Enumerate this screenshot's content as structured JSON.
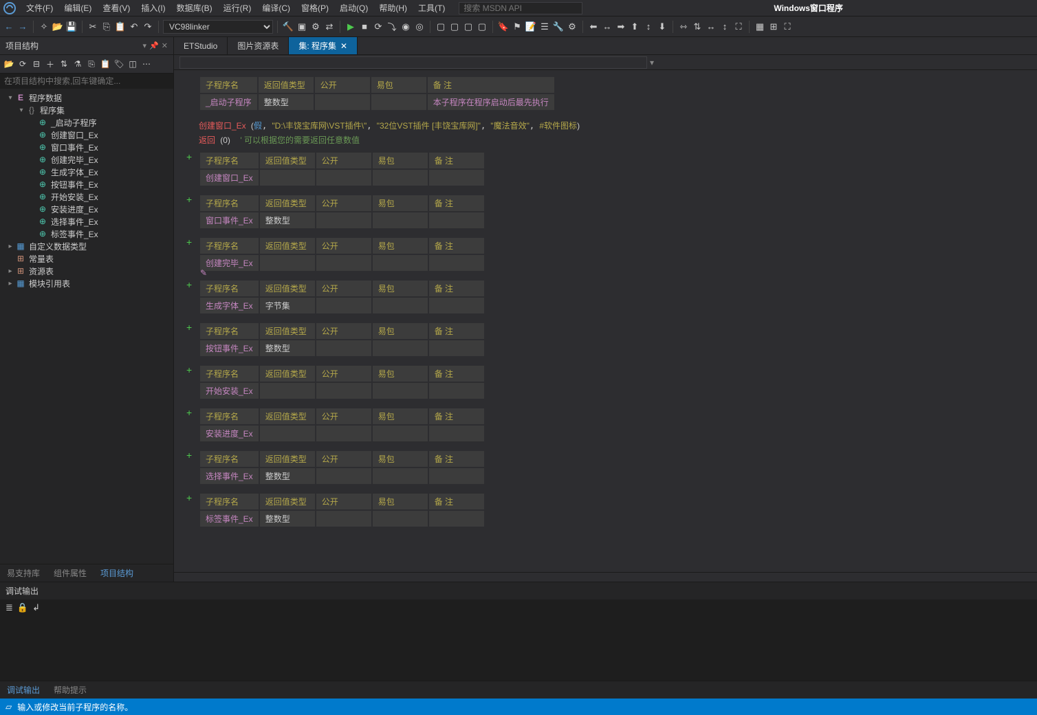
{
  "app_title": "Windows窗口程序",
  "menu": [
    "文件(F)",
    "编辑(E)",
    "查看(V)",
    "插入(I)",
    "数据库(B)",
    "运行(R)",
    "编译(C)",
    "窗格(P)",
    "启动(Q)",
    "帮助(H)",
    "工具(T)"
  ],
  "search_placeholder": "搜索 MSDN API",
  "linker": "VC98linker",
  "sidebar": {
    "title": "项目结构",
    "search_placeholder": "在项目结构中搜索,回车键确定...",
    "bottom_tabs": [
      "易支持库",
      "组件属性",
      "项目结构"
    ],
    "active_bottom": 2,
    "tree": [
      {
        "label": "程序数据",
        "icon": "e",
        "indent": 0,
        "expanded": true
      },
      {
        "label": "程序集",
        "icon": "br",
        "indent": 1,
        "expanded": true
      },
      {
        "label": "_启动子程序",
        "icon": "fn",
        "indent": 2
      },
      {
        "label": "创建窗口_Ex",
        "icon": "fn",
        "indent": 2
      },
      {
        "label": "窗口事件_Ex",
        "icon": "fn",
        "indent": 2
      },
      {
        "label": "创建完毕_Ex",
        "icon": "fn",
        "indent": 2
      },
      {
        "label": "生成字体_Ex",
        "icon": "fn",
        "indent": 2
      },
      {
        "label": "按钮事件_Ex",
        "icon": "fn",
        "indent": 2
      },
      {
        "label": "开始安装_Ex",
        "icon": "fn",
        "indent": 2
      },
      {
        "label": "安装进度_Ex",
        "icon": "fn",
        "indent": 2
      },
      {
        "label": "选择事件_Ex",
        "icon": "fn",
        "indent": 2
      },
      {
        "label": "标签事件_Ex",
        "icon": "fn",
        "indent": 2
      },
      {
        "label": "自定义数据类型",
        "icon": "mod",
        "indent": 0,
        "arrow": true
      },
      {
        "label": "常量表",
        "icon": "db",
        "indent": 0
      },
      {
        "label": "资源表",
        "icon": "db",
        "indent": 0,
        "arrow": true
      },
      {
        "label": "模块引用表",
        "icon": "mod",
        "indent": 0,
        "arrow": true
      }
    ]
  },
  "doc_tabs": [
    {
      "label": "ETStudio",
      "active": false
    },
    {
      "label": "图片资源表",
      "active": false
    },
    {
      "label": "集: 程序集",
      "active": true,
      "closable": true
    }
  ],
  "table_headers": [
    "子程序名",
    "返回值类型",
    "公开",
    "易包",
    "备 注"
  ],
  "subs": [
    {
      "name": "_启动子程序",
      "ret": "整数型",
      "remark": "本子程序在程序启动后最先执行",
      "plus": false,
      "code": true
    },
    {
      "name": "创建窗口_Ex",
      "ret": "",
      "plus": true
    },
    {
      "name": "窗口事件_Ex",
      "ret": "整数型",
      "plus": true
    },
    {
      "name": "创建完毕_Ex",
      "ret": "",
      "plus": true
    },
    {
      "name": "生成字体_Ex",
      "ret": "字节集",
      "plus": true,
      "edit": true
    },
    {
      "name": "按钮事件_Ex",
      "ret": "整数型",
      "plus": true
    },
    {
      "name": "开始安装_Ex",
      "ret": "",
      "plus": true
    },
    {
      "name": "安装进度_Ex",
      "ret": "",
      "plus": true
    },
    {
      "name": "选择事件_Ex",
      "ret": "整数型",
      "plus": true
    },
    {
      "name": "标签事件_Ex",
      "ret": "整数型",
      "plus": true
    }
  ],
  "code_call": {
    "fn": "创建窗口_Ex",
    "args": [
      "假",
      "\"D:\\丰饶宝库网\\VST插件\\\"",
      "\"32位VST插件 [丰饶宝库网]\"",
      "\"魔法音效\"",
      "#软件图标"
    ]
  },
  "code_return": {
    "kw": "返回",
    "val": "(0)",
    "comment": "' 可以根据您的需要返回任意数值"
  },
  "output": {
    "title": "调试输出",
    "tabs": [
      "调试输出",
      "帮助提示"
    ],
    "active": 0
  },
  "status": "输入或修改当前子程序的名称。"
}
